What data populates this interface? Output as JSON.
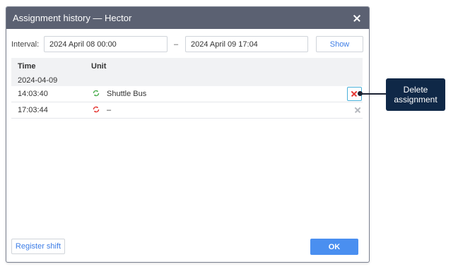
{
  "dialog": {
    "title": "Assignment history — Hector"
  },
  "interval": {
    "label": "Interval:",
    "from": "2024 April 08 00:00",
    "separator": "–",
    "to": "2024 April 09 17:04",
    "show_label": "Show"
  },
  "table": {
    "columns": [
      "Time",
      "Unit"
    ],
    "group_date": "2024-04-09",
    "rows": [
      {
        "time": "14:03:40",
        "unit": "Shuttle Bus",
        "icon": "assign-icon",
        "icon_color": "#4caf50"
      },
      {
        "time": "17:03:44",
        "unit": "–",
        "icon": "unassign-icon",
        "icon_color": "#e53935"
      }
    ]
  },
  "footer": {
    "register_label": "Register shift",
    "ok_label": "OK"
  },
  "callout": {
    "text": "Delete\nassignment"
  },
  "colors": {
    "titlebar": "#5b6172",
    "accent": "#4a8ff0",
    "delete": "#e53935",
    "callout": "#0f2847"
  }
}
